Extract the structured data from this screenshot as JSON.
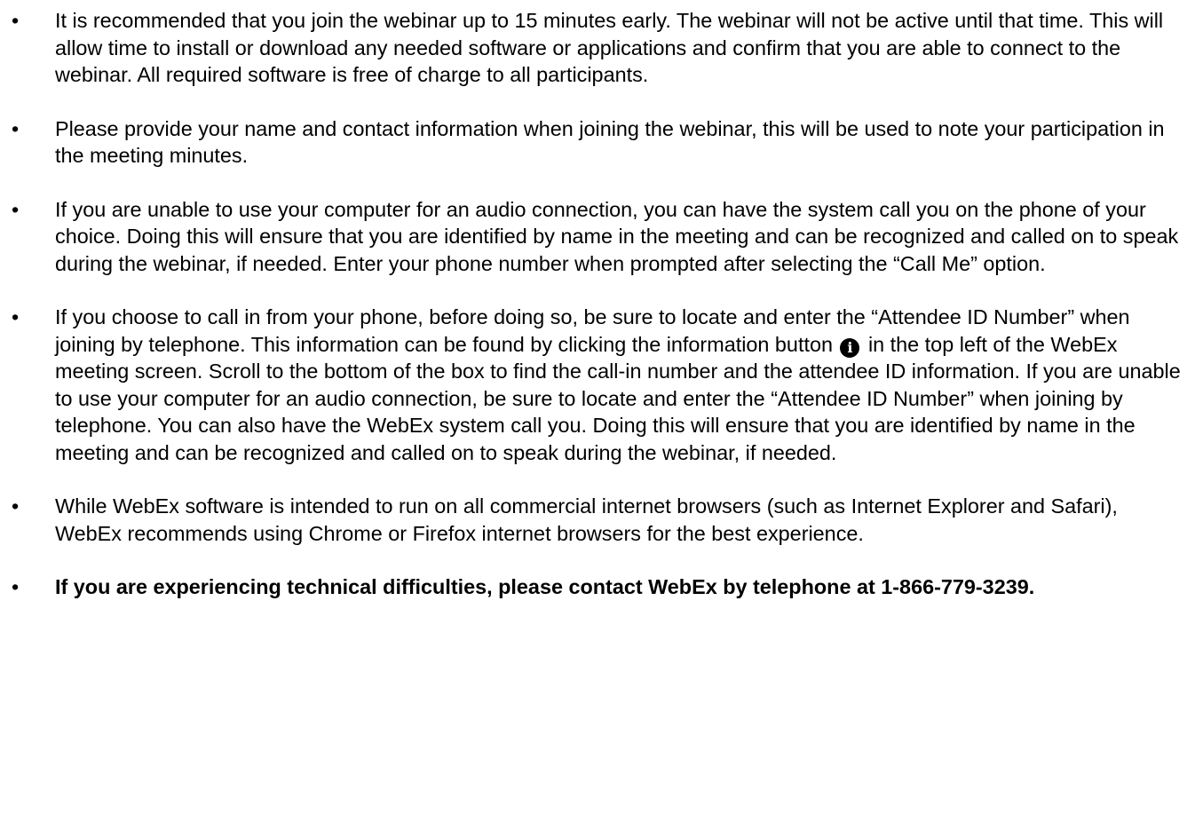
{
  "bullets": [
    {
      "text": "It is recommended that you join the webinar up to 15 minutes early. The webinar will not be active until that time. This will allow time to install or download any needed software or applications and confirm that you are able to connect to the webinar.  All required software is free of charge to all participants."
    },
    {
      "text": "Please provide your name and contact information when joining the webinar, this will be used to note your participation in the meeting minutes."
    },
    {
      "text": "If you are unable to use your computer for an audio connection, you can have the system call you on the phone of your choice. Doing this will ensure that you are identified by name in the meeting and can be recognized and called on to speak during the webinar, if needed. Enter your phone number when prompted after selecting the “Call Me” option."
    },
    {
      "text_before_icon": "If you choose to call in from your phone, before doing so, be sure to locate and enter the “Attendee ID Number” when joining by telephone. This information can be found by clicking the information button ",
      "icon": "info-icon",
      "icon_glyph": "i",
      "text_after_icon": " in the top left of the WebEx meeting screen. Scroll to the bottom of the box to find the call-in number and the attendee ID information. If you are unable to use your computer for an audio connection, be sure to locate and enter the “Attendee ID Number” when joining by telephone. You can also have the WebEx system call you. Doing this will ensure that you are identified by name in the meeting and can be recognized and called on to speak during the webinar, if needed."
    },
    {
      "text": "While WebEx software is intended to run on all commercial internet browsers (such as Internet Explorer and Safari), WebEx recommends using Chrome or Firefox internet browsers for the best experience."
    },
    {
      "text": "If you are experiencing technical difficulties, please contact WebEx by telephone at 1-866-779-3239.",
      "bold": true
    }
  ],
  "bullet_glyph": "•"
}
